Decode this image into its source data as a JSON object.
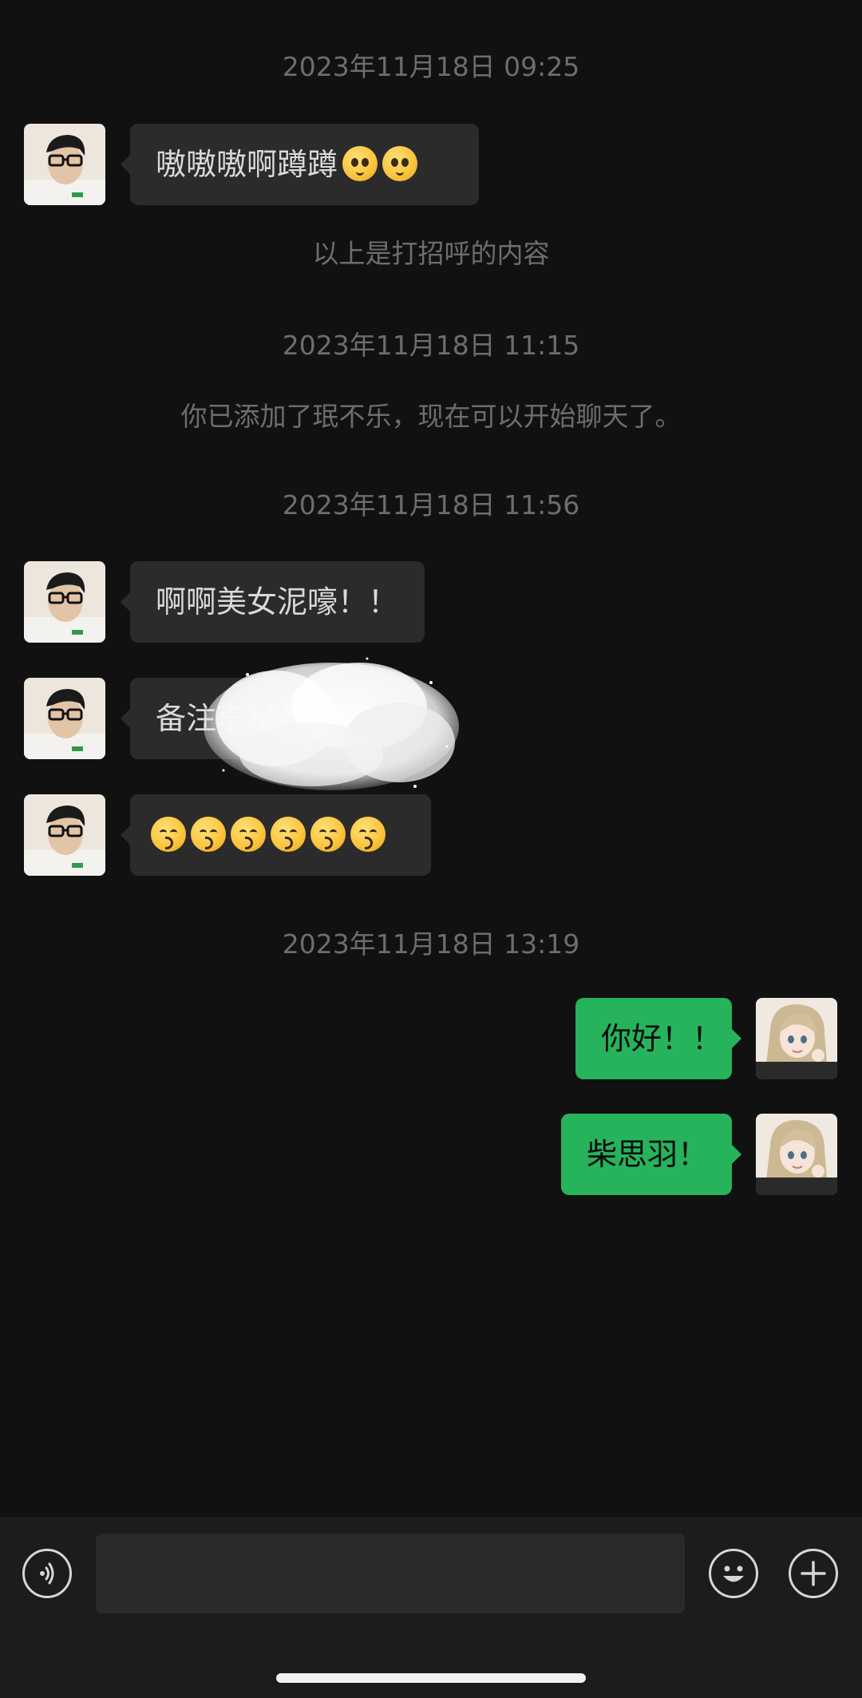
{
  "messages": {
    "ts1": "2023年11月18日 09:25",
    "m1_text": "嗷嗷嗷啊蹲蹲",
    "system1": "以上是打招呼的内容",
    "ts2": "2023年11月18日 11:15",
    "system2": "你已添加了珉不乐，现在可以开始聊天了。",
    "ts3": "2023年11月18日 11:56",
    "m2_text": "啊啊美女泥嚎！！",
    "m3_text": "备注李松月！",
    "ts4": "2023年11月18日 13:19",
    "m5_text": "你好！！",
    "m6_text": "柴思羽！"
  },
  "input": {
    "placeholder": ""
  },
  "icons": {
    "voice": "voice-icon",
    "emoji": "emoji-icon",
    "add": "plus-icon"
  },
  "colors": {
    "background": "#111111",
    "incoming_bubble": "#2b2b2b",
    "outgoing_bubble": "#26b35c",
    "timestamp": "#6d6d6d"
  }
}
